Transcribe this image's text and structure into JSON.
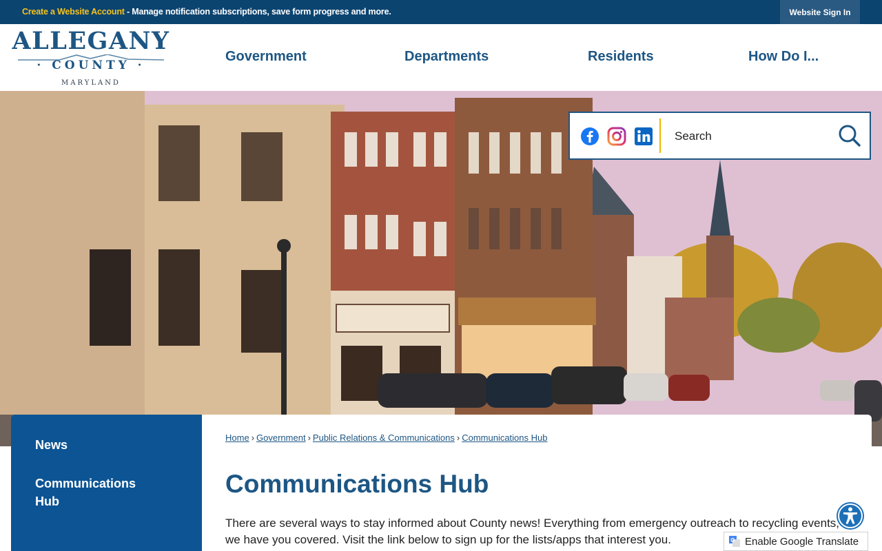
{
  "topbar": {
    "create_link": "Create a Website Account",
    "message": " - Manage notification subscriptions, save form progress and more.",
    "signin": "Website Sign In"
  },
  "logo": {
    "line1": "ALLEGANY",
    "line2": "· COUNTY ·",
    "line3": "MARYLAND"
  },
  "nav": [
    "Government",
    "Departments",
    "Residents",
    "How Do I..."
  ],
  "search": {
    "placeholder": "Search",
    "social_icons": [
      "facebook-icon",
      "instagram-icon",
      "linkedin-icon"
    ]
  },
  "sidebar": {
    "items": [
      "News",
      "Communications Hub"
    ]
  },
  "breadcrumb": [
    "Home",
    "Government",
    "Public Relations & Communications",
    "Communications Hub"
  ],
  "page": {
    "title": "Communications Hub",
    "intro": "There are several ways to stay informed about County news! Everything from emergency outreach to recycling events, we have you covered. Visit the link below to sign up for the lists/apps that interest you."
  },
  "translate": {
    "label": "Enable Google Translate"
  },
  "colors": {
    "brand_navy": "#0c4470",
    "brand_blue": "#1d5684",
    "accent_gold": "#f5c21c",
    "sidebar_blue": "#0c5494"
  }
}
